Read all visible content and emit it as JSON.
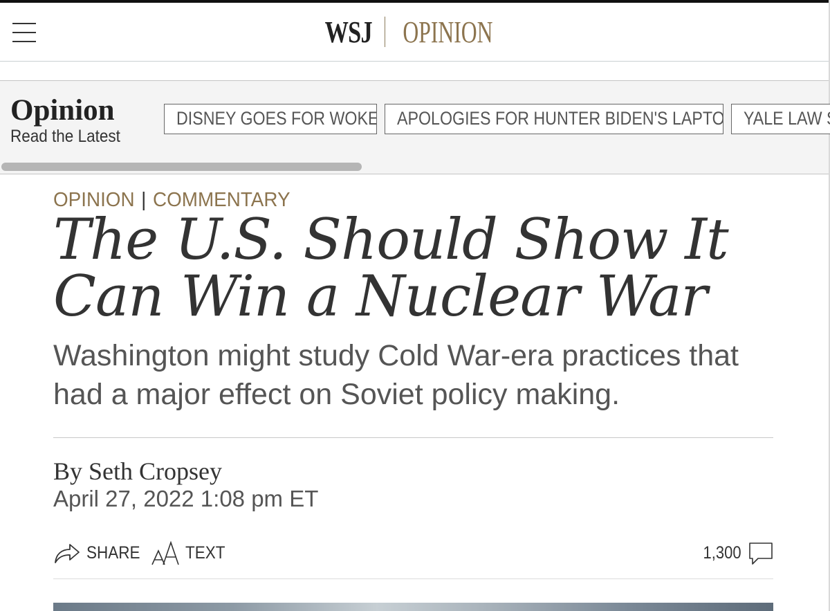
{
  "header": {
    "logo_wsj": "WSJ",
    "logo_section": "OPINION",
    "menu_icon": "hamburger-menu-icon"
  },
  "opinion_strip": {
    "title": "Opinion",
    "subtitle": "Read the Latest",
    "topics": [
      {
        "label": "DISNEY GOES FOR WOKE"
      },
      {
        "label": "APOLOGIES FOR HUNTER BIDEN'S LAPTOP"
      },
      {
        "label": "YALE LAW S"
      }
    ]
  },
  "article": {
    "section": "OPINION",
    "separator": "|",
    "category": "COMMENTARY",
    "headline": "The U.S. Should Show It Can Win a Nuclear War",
    "dek": "Washington might study Cold War-era practices that had a major effect on Soviet policy making.",
    "byline_prefix": "By",
    "author": "Seth Cropsey",
    "date": "April 27, 2022 1:08 pm ET"
  },
  "tools": {
    "share_label": "SHARE",
    "share_icon": "share-arrow-icon",
    "text_label": "TEXT",
    "text_icon": "text-size-icon",
    "comment_count": "1,300",
    "comment_icon": "comment-bubble-icon"
  },
  "colors": {
    "accent": "#8c744e",
    "headline": "#333333",
    "dek": "#555555"
  }
}
